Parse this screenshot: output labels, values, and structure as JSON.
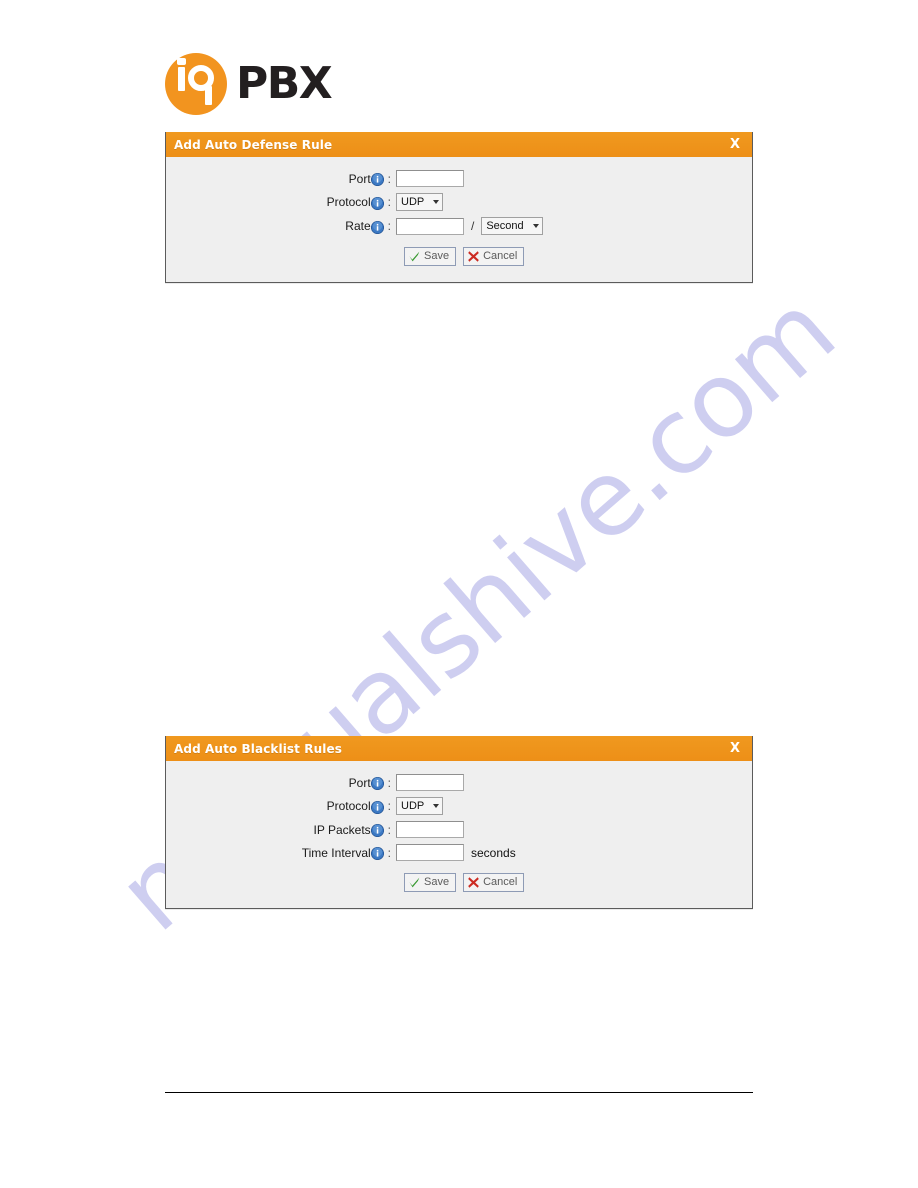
{
  "brand": {
    "logo_mark_text": "iQ",
    "logo_word": "PBX",
    "accent_color": "#f2941f",
    "word_color": "#231f20"
  },
  "watermark": {
    "text": "manualshive.com",
    "color": "#ccccf0"
  },
  "panels": [
    {
      "title": "Add Auto Defense Rule",
      "close_label": "X",
      "rows": [
        {
          "label": "Port",
          "info_icon": "info-icon",
          "colon": ":",
          "control": "text",
          "value": "",
          "suffix": ""
        },
        {
          "label": "Protocol",
          "info_icon": "info-icon",
          "colon": ":",
          "control": "select",
          "value": "UDP",
          "suffix": ""
        },
        {
          "label": "Rate",
          "info_icon": "info-icon",
          "colon": ":",
          "control": "text-slash-select",
          "value": "",
          "separator": "/",
          "unit": "Second",
          "suffix": ""
        }
      ],
      "buttons": [
        {
          "label": "Save",
          "icon": "check-icon",
          "color": "#3a9a32"
        },
        {
          "label": "Cancel",
          "icon": "red-x-icon",
          "color": "#cc2b22"
        }
      ]
    },
    {
      "title": "Add Auto Blacklist Rules",
      "close_label": "X",
      "rows": [
        {
          "label": "Port",
          "info_icon": "info-icon",
          "colon": ":",
          "control": "text",
          "value": "",
          "suffix": ""
        },
        {
          "label": "Protocol",
          "info_icon": "info-icon",
          "colon": ":",
          "control": "select",
          "value": "UDP",
          "suffix": ""
        },
        {
          "label": "IP Packets",
          "info_icon": "info-icon",
          "colon": ":",
          "control": "text",
          "value": "",
          "suffix": ""
        },
        {
          "label": "Time Interval",
          "info_icon": "info-icon",
          "colon": ":",
          "control": "text",
          "value": "",
          "suffix": "seconds"
        }
      ],
      "buttons": [
        {
          "label": "Save",
          "icon": "check-icon",
          "color": "#3a9a32"
        },
        {
          "label": "Cancel",
          "icon": "red-x-icon",
          "color": "#cc2b22"
        }
      ]
    }
  ]
}
